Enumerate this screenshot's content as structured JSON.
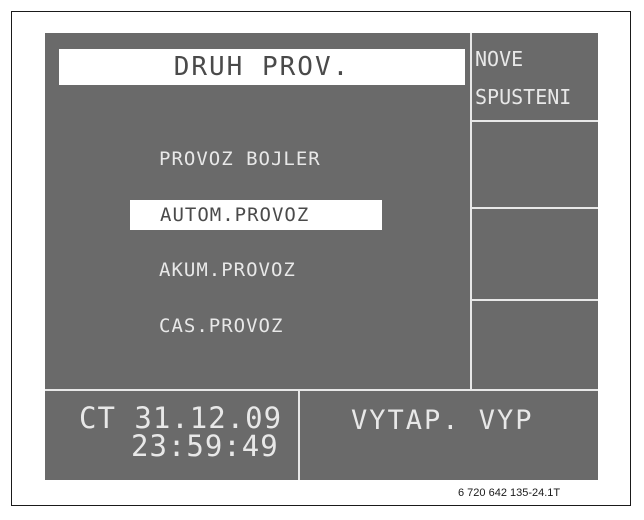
{
  "screen": {
    "title": "DRUH PROV.",
    "softkey_top": {
      "line1": "NOVE",
      "line2": "SPUSTENI"
    },
    "menu": [
      {
        "label": "PROVOZ BOJLER",
        "selected": false
      },
      {
        "label": "AUTOM.PROVOZ",
        "selected": true
      },
      {
        "label": "AKUM.PROVOZ",
        "selected": false
      },
      {
        "label": "CAS.PROVOZ",
        "selected": false
      }
    ],
    "status": {
      "day_date": "CT 31.12.09",
      "time": "23:59:49",
      "heating": "VYTAP. VYP"
    }
  },
  "caption": "6 720 642 135-24.1T",
  "colors": {
    "lcd_background": "#6a6a6a",
    "lcd_text": "#e8e8e8",
    "highlight_background": "#ffffff",
    "highlight_text": "#4a4a4a"
  }
}
